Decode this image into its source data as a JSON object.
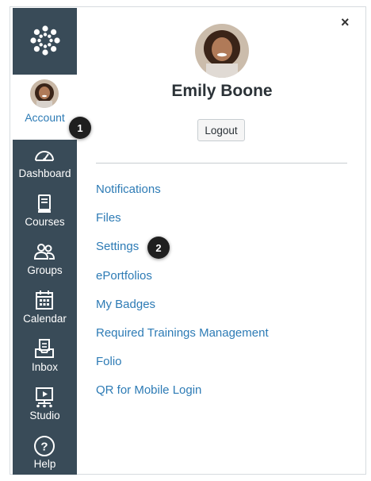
{
  "sidebar": {
    "logo": "canvas-logo-icon",
    "account_label": "Account",
    "items": [
      {
        "label": "Dashboard",
        "icon": "dashboard-icon"
      },
      {
        "label": "Courses",
        "icon": "courses-icon"
      },
      {
        "label": "Groups",
        "icon": "groups-icon"
      },
      {
        "label": "Calendar",
        "icon": "calendar-icon"
      },
      {
        "label": "Inbox",
        "icon": "inbox-icon"
      },
      {
        "label": "Studio",
        "icon": "studio-icon"
      },
      {
        "label": "Help",
        "icon": "help-icon"
      }
    ]
  },
  "callouts": {
    "one": "1",
    "two": "2"
  },
  "panel": {
    "close": "×",
    "user_name": "Emily Boone",
    "logout_label": "Logout",
    "links": [
      "Notifications",
      "Files",
      "Settings",
      "ePortfolios",
      "My Badges",
      "Required Trainings Management",
      "Folio",
      "QR for Mobile Login"
    ]
  },
  "colors": {
    "sidebar_bg": "#394b58",
    "link": "#2d7bb5",
    "account_label": "#2d7bb5",
    "name_text": "#2b3237"
  }
}
